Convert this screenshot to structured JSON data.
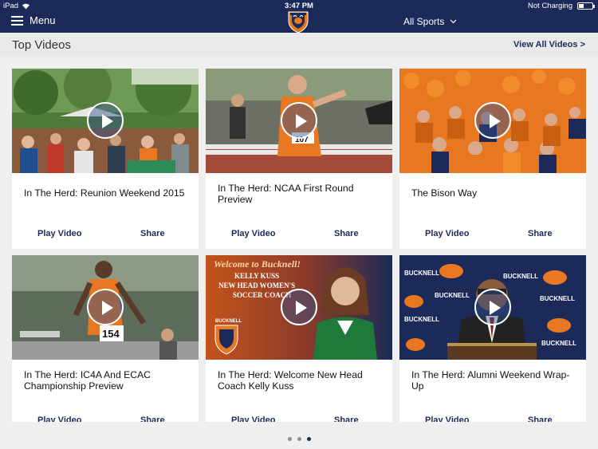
{
  "status_bar": {
    "device": "iPad",
    "time": "3:47 PM",
    "charging": "Not Charging",
    "battery_level": 0.35
  },
  "nav": {
    "menu_label": "Menu",
    "sports_label": "All Sports",
    "logo_icon": "bucknell-bison-logo"
  },
  "section": {
    "title": "Top Videos",
    "view_all": "View All Videos >"
  },
  "videos": [
    {
      "title": "In The Herd: Reunion Weekend 2015",
      "play_label": "Play Video",
      "share_label": "Share",
      "thumb": "outdoor-reunion-crowd"
    },
    {
      "title": "In The Herd: NCAA First Round Preview",
      "play_label": "Play Video",
      "share_label": "Share",
      "thumb": "hurdler-bib-107"
    },
    {
      "title": "The Bison Way",
      "play_label": "Play Video",
      "share_label": "Share",
      "thumb": "orange-fans-stands"
    },
    {
      "title": "In The Herd: IC4A And ECAC Championship Preview",
      "play_label": "Play Video",
      "share_label": "Share",
      "thumb": "runner-bib-154"
    },
    {
      "title": "In The Herd: Welcome New Head Coach Kelly Kuss",
      "play_label": "Play Video",
      "share_label": "Share",
      "thumb": "coach-welcome-graphic",
      "thumb_text": {
        "line1": "Welcome to Bucknell!",
        "line2": "KELLY KUSS",
        "line3": "NEW HEAD WOMEN'S",
        "line4": "SOCCER COACH",
        "brand": "BUCKNELL"
      }
    },
    {
      "title": "In The Herd: Alumni Weekend Wrap-Up",
      "play_label": "Play Video",
      "share_label": "Share",
      "thumb": "speaker-at-podium",
      "thumb_text": {
        "brand": "BUCKNELL"
      }
    }
  ],
  "pager": {
    "pages": 3,
    "current": 3
  },
  "colors": {
    "navy": "#1b2a58",
    "orange": "#e87722",
    "background": "#efefef"
  }
}
